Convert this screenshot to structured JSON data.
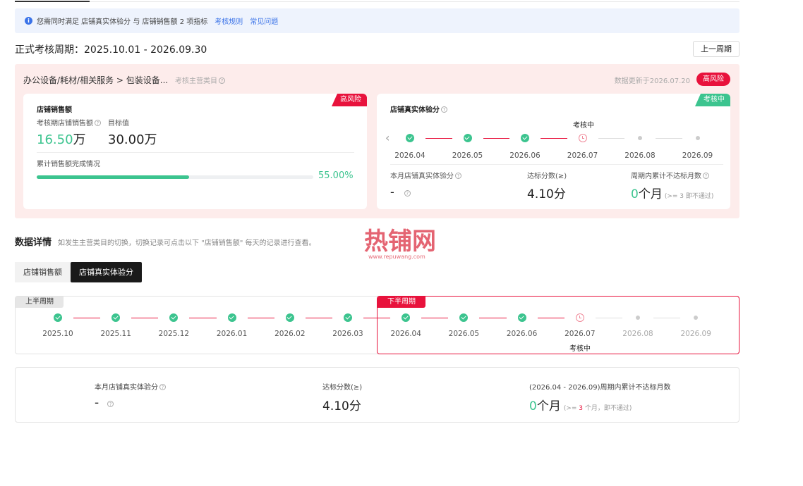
{
  "notice": {
    "text": "您需同时满足 店铺真实体验分 与 店铺销售额 2 项指标",
    "link_rules": "考核规则",
    "link_faq": "常见问题"
  },
  "period": {
    "title": "正式考核周期：2025.10.01 - 2026.09.30",
    "prev_button": "上一周期"
  },
  "risk_panel": {
    "breadcrumb": "办公设备/耗材/相关服务 > 包装设备...",
    "breadcrumb_note": "考核主营类目",
    "update_text": "数据更新于2026.07.20",
    "risk_badge": "高风险",
    "colors": {
      "risk": "#e8123c",
      "ok": "#3cc48f",
      "panel_bg": "#fdeceb"
    }
  },
  "sales_card": {
    "corner_tag": "高风险",
    "title": "店铺销售额",
    "period_sales_label": "考核期店铺销售额",
    "target_label": "目标值",
    "period_sales_value": "16.50",
    "period_sales_unit": "万",
    "target_value": "30.00万",
    "progress_label": "累计销售额完成情况",
    "progress_percent": "55.00%",
    "progress_fraction": 0.55
  },
  "experience_card": {
    "corner_tag": "考核中",
    "title": "店铺真实体验分",
    "status_label": "考核中",
    "months": [
      "2026.04",
      "2026.05",
      "2026.06",
      "2026.07",
      "2026.08",
      "2026.09"
    ],
    "month_states": [
      "done",
      "done",
      "done",
      "review",
      "pending",
      "pending"
    ],
    "monthly_score_label": "本月店铺真实体验分",
    "monthly_score_value": "-",
    "threshold_label": "达标分数(≥)",
    "threshold_value": "4.10分",
    "fail_months_label": "周期内累计不达标月数",
    "fail_months_value": "0",
    "fail_months_unit": "个月",
    "fail_months_hint": "(>= 3 即不通过)"
  },
  "details": {
    "title": "数据详情",
    "subtitle": "如发生主营类目的切换，切换记录可点击以下 \"店铺销售额\" 每天的记录进行查看。",
    "tabs": [
      "店铺销售额",
      "店铺真实体验分"
    ],
    "active_tab": 1
  },
  "timeline": {
    "first_half_tag": "上半周期",
    "second_half_tag": "下半周期",
    "months": [
      "2025.10",
      "2025.11",
      "2025.12",
      "2026.01",
      "2026.02",
      "2026.03",
      "2026.04",
      "2026.05",
      "2026.06",
      "2026.07",
      "2026.08",
      "2026.09"
    ],
    "states": [
      "done",
      "done",
      "done",
      "done",
      "done",
      "done",
      "done",
      "done",
      "done",
      "review",
      "pending",
      "pending"
    ],
    "review_label": "考核中"
  },
  "summary": {
    "monthly_score_label": "本月店铺真实体验分",
    "monthly_score_value": "-",
    "threshold_label": "达标分数(≥)",
    "threshold_value": "4.10分",
    "fail_months_label": "(2026.04 - 2026.09)周期内累计不达标月数",
    "fail_months_value": "0",
    "fail_months_unit": "个月",
    "hint_prefix": "(>=",
    "hint_number": "3",
    "hint_suffix": "个月，即不通过)"
  },
  "watermark": {
    "text": "热铺网",
    "url": "www.repuwang.com"
  }
}
